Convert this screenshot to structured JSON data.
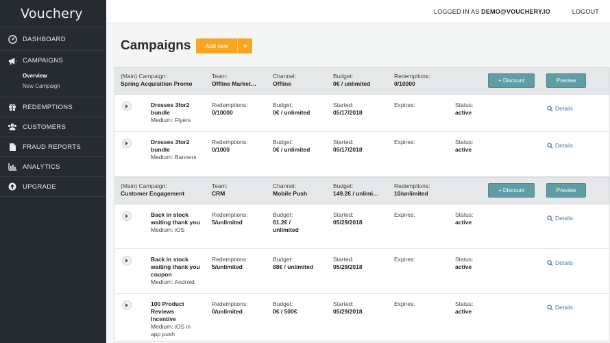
{
  "app": {
    "logo": "Vouchery"
  },
  "sidebar": {
    "items": [
      {
        "label": "DASHBOARD",
        "icon": "dashboard-icon"
      },
      {
        "label": "CAMPAIGNS",
        "icon": "megaphone-icon",
        "sub": [
          "Overview",
          "New Campaign"
        ]
      },
      {
        "label": "REDEMPTIONS",
        "icon": "gift-icon"
      },
      {
        "label": "CUSTOMERS",
        "icon": "users-icon"
      },
      {
        "label": "FRAUD REPORTS",
        "icon": "document-icon"
      },
      {
        "label": "ANALYTICS",
        "icon": "bar-chart-icon"
      },
      {
        "label": "UPGRADE",
        "icon": "upgrade-icon"
      }
    ]
  },
  "topbar": {
    "logged_prefix": "LOGGED IN AS",
    "user": "DEMO@VOUCHERY.IO",
    "logout": "LOGOUT"
  },
  "page": {
    "title": "Campaigns",
    "add_label": "Add new",
    "add_plus": "+"
  },
  "labels": {
    "main_campaign": "(Main) Campaign:",
    "team": "Team:",
    "channel": "Channel:",
    "budget": "Budget:",
    "redemptions": "Redemptions:",
    "started": "Started:",
    "expires": "Expires:",
    "status": "Status:",
    "discount_btn": "+ Discount",
    "preview_btn": "Preview",
    "details": "Details"
  },
  "campaigns": [
    {
      "name": "Spring Acquisition Promo",
      "team": "Offline Market…",
      "channel": "Offline",
      "budget": "0€ / unlimited",
      "redemptions": "0/10000",
      "vouchers": [
        {
          "name": "Dresses 3for2 bundle",
          "medium": "Medium: Flyers",
          "redemptions": "0/10000",
          "budget": "0€ / unlimited",
          "started": "05/17/2018",
          "expires": "",
          "status": "active"
        },
        {
          "name": "Dresses 3for2 bundle",
          "medium": "Medium: Banners",
          "redemptions": "0/1000",
          "budget": "0€ / unlimited",
          "started": "05/17/2018",
          "expires": "",
          "status": "active"
        }
      ]
    },
    {
      "name": "Customer Engagement",
      "team": "CRM",
      "channel": "Mobile Push",
      "budget": "149.2€ / unlimi…",
      "redemptions": "10/unlimited",
      "vouchers": [
        {
          "name": "Back in stock waiting thank you",
          "medium": "Medium: iOS",
          "redemptions": "5/unlimited",
          "budget": "61.2€ / unlimited",
          "started": "05/29/2018",
          "expires": "",
          "status": "active"
        },
        {
          "name": "Back in stock waiting thank you coupon",
          "medium": "Medium: Android",
          "redemptions": "5/unlimited",
          "budget": "88€ / unlimited",
          "started": "05/29/2018",
          "expires": "",
          "status": "active"
        },
        {
          "name": "100 Product Reviews Incentive",
          "medium": "Medium: iOS in app push",
          "redemptions": "0/unlimited",
          "budget": "0€ / 500€",
          "started": "05/29/2018",
          "expires": "",
          "status": "active"
        }
      ]
    }
  ]
}
